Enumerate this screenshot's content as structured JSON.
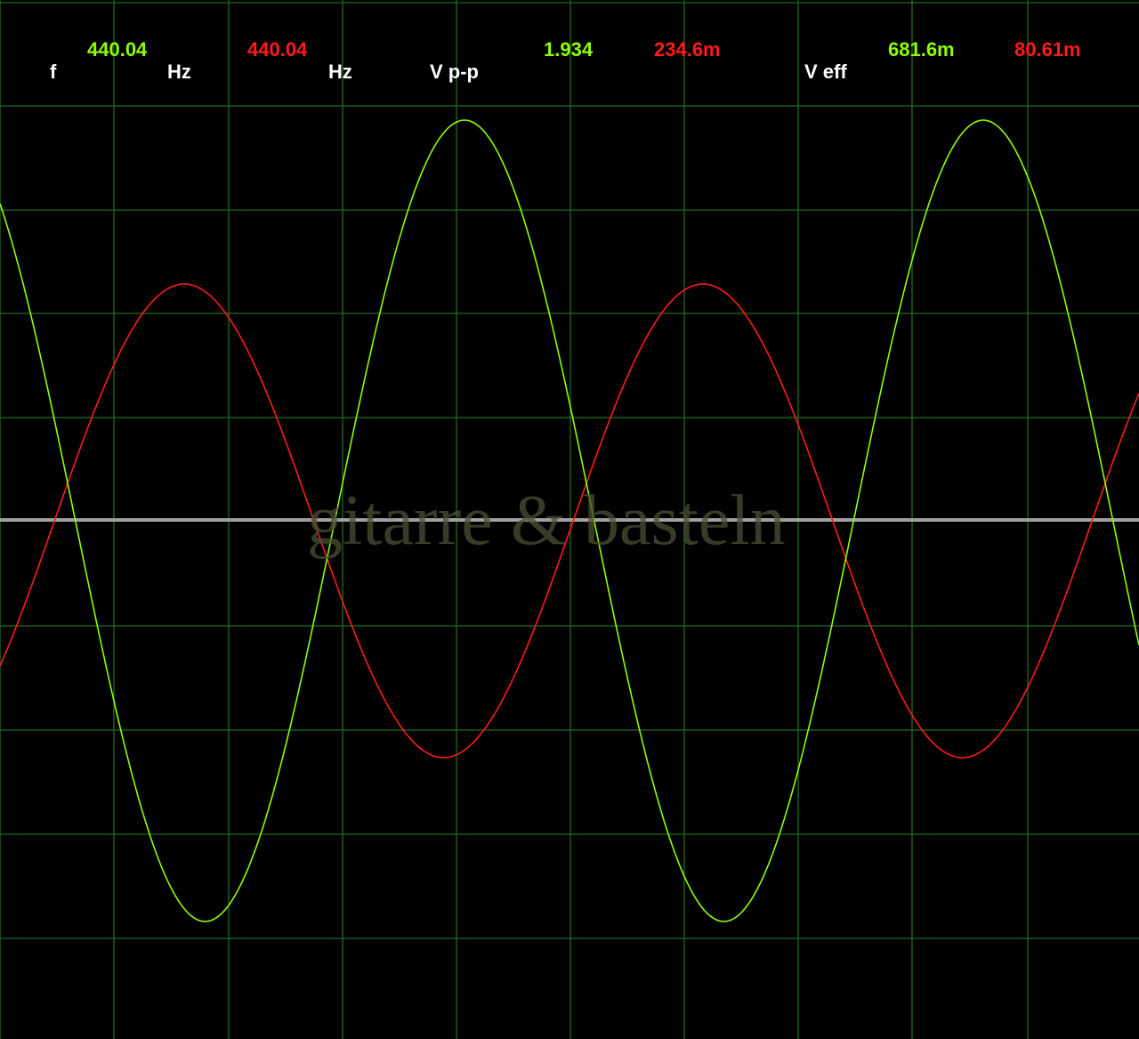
{
  "readouts": {
    "freq_label": "f",
    "freq_ch1": "440.04",
    "freq_ch1_unit": "Hz",
    "freq_ch2": "440.04",
    "freq_ch2_unit": "Hz",
    "vpp_label": "V p-p",
    "vpp_ch1": "1.934",
    "vpp_ch2": "234.6m",
    "veff_label": "V eff",
    "veff_ch1": "681.6m",
    "veff_ch2": "80.61m"
  },
  "watermark": "gitarre & basteln",
  "colors": {
    "background": "#000000",
    "grid": "#1f6b1f",
    "baseline": "#a0a0a0",
    "channel_1": "#8cff00",
    "channel_2": "#ff1a1a",
    "label_text": "#ffffff"
  },
  "chart_data": {
    "type": "line",
    "grid": true,
    "series": [
      {
        "color": "#8cff00",
        "frequency_hz": 440.04,
        "peak_to_peak_v": 1.934,
        "rms_v": 0.6816
      },
      {
        "color": "#ff1a1a",
        "frequency_hz": 440.04,
        "peak_to_peak_v": 0.2346,
        "rms_v": 0.08061
      }
    ]
  }
}
